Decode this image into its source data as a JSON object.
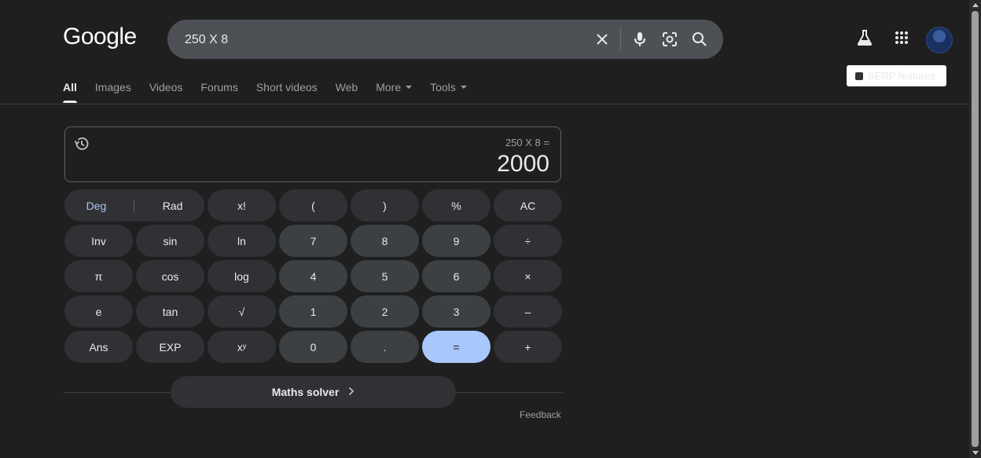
{
  "logo": "Google",
  "search": {
    "query": "250 X 8"
  },
  "serp_features": "SERP features",
  "tabs": [
    "All",
    "Images",
    "Videos",
    "Forums",
    "Short videos",
    "Web",
    "More",
    "Tools"
  ],
  "calculator": {
    "expression": "250 X 8 =",
    "result": "2000",
    "keys": {
      "deg": "Deg",
      "rad": "Rad",
      "fact": "x!",
      "lparen": "(",
      "rparen": ")",
      "percent": "%",
      "ac": "AC",
      "inv": "Inv",
      "sin": "sin",
      "ln": "ln",
      "k7": "7",
      "k8": "8",
      "k9": "9",
      "divide": "÷",
      "pi": "π",
      "cos": "cos",
      "log": "log",
      "k4": "4",
      "k5": "5",
      "k6": "6",
      "multiply": "×",
      "e": "e",
      "tan": "tan",
      "sqrt": "√",
      "k1": "1",
      "k2": "2",
      "k3": "3",
      "minus": "–",
      "ans": "Ans",
      "exp": "EXP",
      "pow": "xʸ",
      "k0": "0",
      "dot": ".",
      "equals": "=",
      "plus": "+"
    }
  },
  "maths_solver": "Maths solver",
  "feedback": "Feedback",
  "colors": {
    "background": "#1f1f1f",
    "equals_key": "#a8c7fa",
    "accent": "#a8c7fa"
  }
}
